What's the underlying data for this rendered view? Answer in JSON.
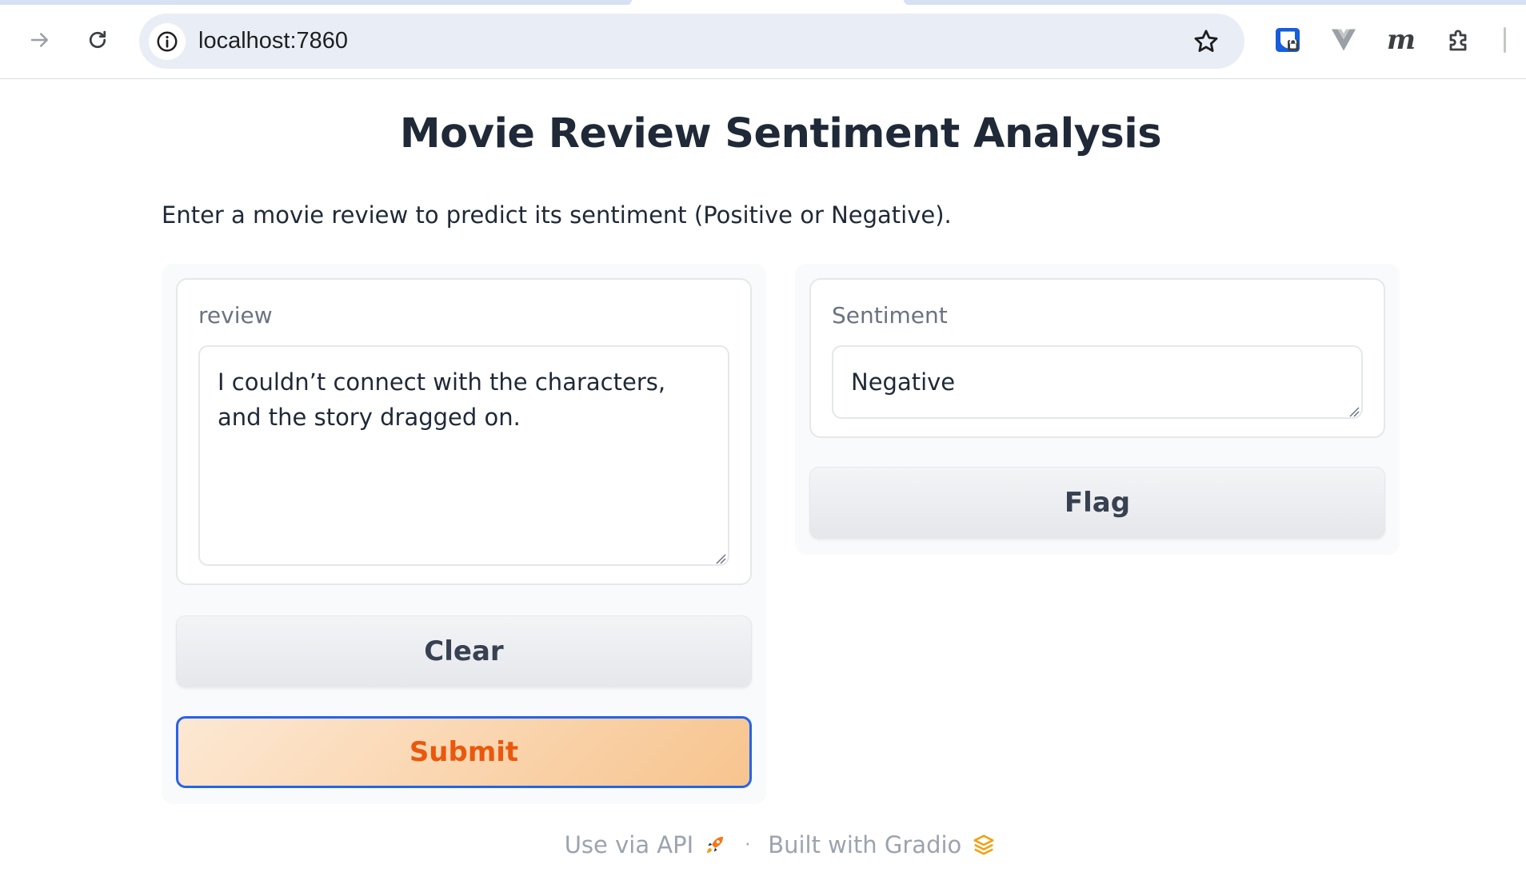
{
  "browser": {
    "url": "localhost:7860"
  },
  "page": {
    "title": "Movie Review Sentiment Analysis",
    "description": "Enter a movie review to predict its sentiment (Positive or Negative)."
  },
  "input": {
    "label": "review",
    "value": "I couldn’t connect with the characters, and the story dragged on."
  },
  "output": {
    "label": "Sentiment",
    "value": "Negative"
  },
  "buttons": {
    "clear": "Clear",
    "submit": "Submit",
    "flag": "Flag"
  },
  "footer": {
    "api_link": "Use via API",
    "separator": "·",
    "built_with": "Built with Gradio"
  },
  "colors": {
    "primary_text": "#ea580c",
    "primary_border": "#2563eb",
    "gradio_orange": "#f59e0b"
  }
}
